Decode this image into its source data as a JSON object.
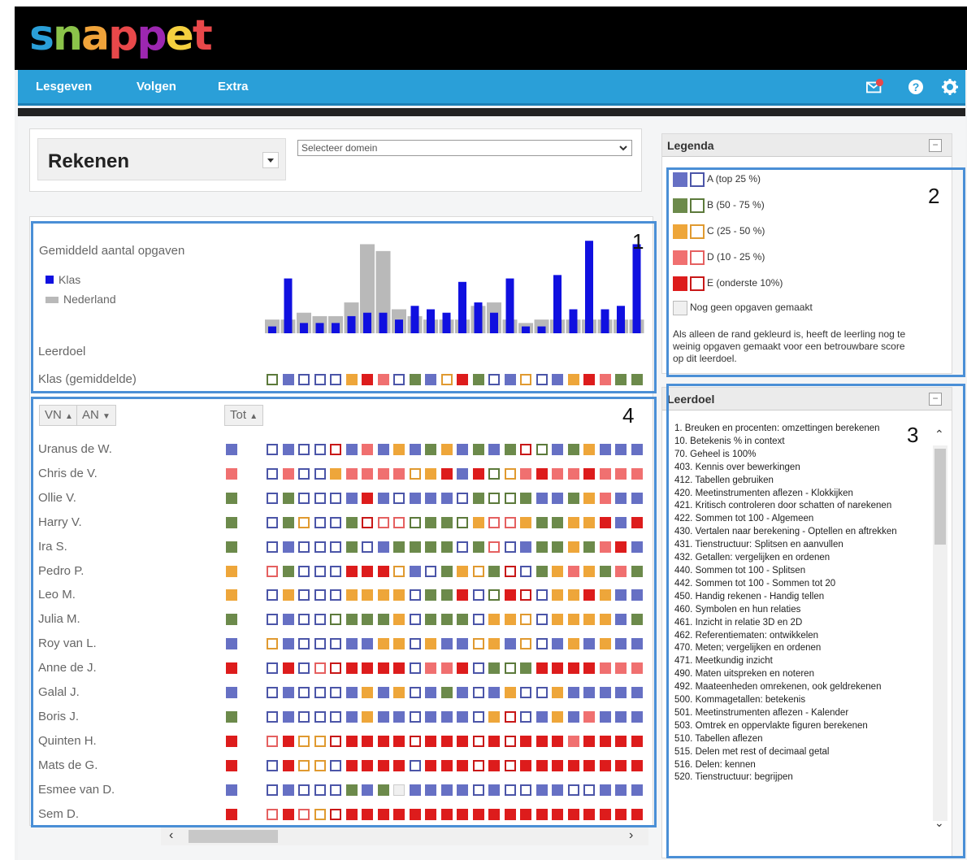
{
  "app": {
    "logo": "snappet",
    "logo_colors": [
      "#2a9fd8",
      "#8bc34a",
      "#f0a33a",
      "#e8484a",
      "#9c27b0",
      "#f4d03f",
      "#e8484a"
    ]
  },
  "nav": {
    "items": [
      "Lesgeven",
      "Volgen",
      "Extra"
    ],
    "icons": [
      "mail-icon",
      "help-icon",
      "gear-icon"
    ]
  },
  "filters": {
    "subject": "Rekenen",
    "domain_placeholder": "Selecteer domein"
  },
  "colors": {
    "A": "#6670c4",
    "B": "#6c8a4b",
    "C": "#eea63a",
    "D": "#f07070",
    "E": "#dd1c1c",
    "none": "#ffffff",
    "border_A": "#4b55a8",
    "border_B": "#5c7a3b",
    "border_C": "#e09a30",
    "border_D": "#e56060",
    "border_E": "#c81818",
    "class_bar": "#1010e0",
    "nl_bar": "#b9b9b9",
    "highlight": "#4a8fd6"
  },
  "chart": {
    "title": "Gemiddeld aantal opgaven",
    "legend": [
      "Klas",
      "Nederland"
    ],
    "row_leerdoel": "Leerdoel",
    "row_klas": "Klas (gemiddelde)",
    "callout": "1"
  },
  "chart_data": {
    "type": "bar",
    "title": "Gemiddeld aantal opgaven",
    "series": [
      {
        "name": "Klas",
        "values": [
          2,
          16,
          3,
          3,
          3,
          5,
          6,
          6,
          4,
          8,
          7,
          6,
          15,
          9,
          6,
          16,
          2,
          2,
          17,
          7,
          27,
          7,
          8,
          26
        ]
      },
      {
        "name": "Nederland",
        "values": [
          4,
          4,
          6,
          5,
          5,
          9,
          26,
          24,
          7,
          5,
          4,
          4,
          4,
          8,
          9,
          4,
          3,
          4,
          4,
          4,
          4,
          4,
          4,
          4
        ]
      }
    ]
  },
  "klas_avg": [
    "oB",
    "A",
    "oA",
    "oA",
    "oA",
    "C",
    "E",
    "D",
    "oA",
    "B",
    "A",
    "oC",
    "E",
    "B",
    "oA",
    "A",
    "oC",
    "oA",
    "A",
    "C",
    "E",
    "D",
    "B",
    "B"
  ],
  "legend_panel": {
    "title": "Legenda",
    "callout": "2",
    "rows": [
      {
        "key": "A",
        "label": "A (top 25 %)"
      },
      {
        "key": "B",
        "label": "B (50 - 75 %)"
      },
      {
        "key": "C",
        "label": "C (25 - 50 %)"
      },
      {
        "key": "D",
        "label": "D (10 - 25 %)"
      },
      {
        "key": "E",
        "label": "E (onderste 10%)"
      }
    ],
    "none_label": "Nog geen opgaven gemaakt",
    "note": "Als alleen de rand gekleurd is, heeft de leerling nog te weinig opgaven gemaakt voor een betrouwbare score op dit leerdoel."
  },
  "goal_panel": {
    "title": "Leerdoel",
    "callout": "3",
    "items": [
      "1. Breuken en procenten: omzettingen berekenen",
      "10. Betekenis % in context",
      "70. Geheel is 100%",
      "403. Kennis over bewerkingen",
      "412. Tabellen gebruiken",
      "420. Meetinstrumenten aflezen - Klokkijken",
      "421. Kritisch controleren door schatten of narekenen",
      "422. Sommen tot 100 - Algemeen",
      "430. Vertalen naar berekening - Optellen en aftrekken",
      "431. Tienstructuur: Splitsen en aanvullen",
      "432. Getallen: vergelijken en ordenen",
      "440. Sommen tot 100 - Splitsen",
      "442. Sommen tot 100 - Sommen tot 20",
      "450. Handig rekenen - Handig tellen",
      "460. Symbolen en hun relaties",
      "461. Inzicht in relatie 3D en 2D",
      "462. Referentiematen: ontwikkelen",
      "470. Meten; vergelijken en ordenen",
      "471. Meetkundig inzicht",
      "490. Maten uitspreken en noteren",
      "492. Maateenheden omrekenen, ook geldrekenen",
      "500. Kommagetallen: betekenis",
      "501. Meetinstrumenten aflezen - Kalender",
      "503. Omtrek en oppervlakte figuren berekenen",
      "510. Tabellen aflezen",
      "515. Delen met rest of decimaal getal",
      "516. Delen: kennen",
      "520. Tienstructuur: begrijpen"
    ]
  },
  "students_panel": {
    "callout": "4",
    "sort_vn": "VN",
    "sort_an": "AN",
    "sort_tot": "Tot",
    "students": [
      {
        "name": "Uranus de W.",
        "tot": "A",
        "cells": [
          "oA",
          "A",
          "oA",
          "oA",
          "oE",
          "A",
          "D",
          "A",
          "C",
          "A",
          "B",
          "C",
          "A",
          "B",
          "A",
          "B",
          "oE",
          "oB",
          "A",
          "B",
          "C",
          "A",
          "A",
          "A"
        ]
      },
      {
        "name": "Chris de V.",
        "tot": "D",
        "cells": [
          "oA",
          "D",
          "oA",
          "oA",
          "C",
          "D",
          "D",
          "D",
          "D",
          "oC",
          "C",
          "E",
          "A",
          "E",
          "oB",
          "oC",
          "D",
          "E",
          "D",
          "D",
          "E",
          "D",
          "D",
          "D"
        ]
      },
      {
        "name": "Ollie V.",
        "tot": "B",
        "cells": [
          "oA",
          "B",
          "oA",
          "oA",
          "oA",
          "A",
          "E",
          "A",
          "oA",
          "A",
          "A",
          "A",
          "oA",
          "B",
          "oB",
          "oB",
          "B",
          "A",
          "A",
          "B",
          "C",
          "D",
          "A",
          "A"
        ]
      },
      {
        "name": "Harry V.",
        "tot": "B",
        "cells": [
          "oA",
          "B",
          "oC",
          "oA",
          "oA",
          "B",
          "oE",
          "oD",
          "oD",
          "oB",
          "B",
          "B",
          "oB",
          "C",
          "oD",
          "oD",
          "C",
          "B",
          "B",
          "C",
          "C",
          "E",
          "A",
          "E"
        ]
      },
      {
        "name": "Ira S.",
        "tot": "B",
        "cells": [
          "oA",
          "A",
          "oA",
          "oA",
          "oA",
          "B",
          "oA",
          "A",
          "B",
          "B",
          "B",
          "B",
          "oA",
          "B",
          "oD",
          "oA",
          "A",
          "B",
          "B",
          "C",
          "B",
          "D",
          "E",
          "A"
        ]
      },
      {
        "name": "Pedro P.",
        "tot": "C",
        "cells": [
          "oD",
          "B",
          "oA",
          "oA",
          "oA",
          "E",
          "E",
          "E",
          "oC",
          "A",
          "oA",
          "B",
          "C",
          "oC",
          "B",
          "oE",
          "oA",
          "B",
          "C",
          "D",
          "C",
          "B",
          "D",
          "B"
        ]
      },
      {
        "name": "Leo M.",
        "tot": "C",
        "cells": [
          "oA",
          "C",
          "oA",
          "oA",
          "oA",
          "C",
          "C",
          "C",
          "C",
          "oA",
          "B",
          "B",
          "E",
          "oA",
          "oB",
          "E",
          "oE",
          "oA",
          "C",
          "C",
          "E",
          "C",
          "A",
          "A"
        ]
      },
      {
        "name": "Julia M.",
        "tot": "B",
        "cells": [
          "oA",
          "A",
          "oA",
          "oA",
          "oB",
          "B",
          "B",
          "B",
          "C",
          "oA",
          "B",
          "B",
          "B",
          "oA",
          "C",
          "C",
          "oC",
          "oA",
          "C",
          "C",
          "C",
          "C",
          "A",
          "B"
        ]
      },
      {
        "name": "Roy van L.",
        "tot": "A",
        "cells": [
          "oC",
          "A",
          "oA",
          "oA",
          "oA",
          "A",
          "A",
          "C",
          "C",
          "oA",
          "C",
          "A",
          "A",
          "oC",
          "C",
          "A",
          "oC",
          "oA",
          "A",
          "C",
          "A",
          "C",
          "A",
          "A"
        ]
      },
      {
        "name": "Anne de J.",
        "tot": "E",
        "cells": [
          "oA",
          "E",
          "oA",
          "oD",
          "oE",
          "E",
          "E",
          "E",
          "E",
          "oA",
          "D",
          "D",
          "E",
          "oA",
          "B",
          "oB",
          "B",
          "E",
          "E",
          "E",
          "E",
          "D",
          "D",
          "D"
        ]
      },
      {
        "name": "Galal J.",
        "tot": "A",
        "cells": [
          "oA",
          "A",
          "oA",
          "oA",
          "oA",
          "A",
          "C",
          "A",
          "C",
          "oA",
          "A",
          "B",
          "A",
          "oA",
          "A",
          "C",
          "oA",
          "oA",
          "C",
          "A",
          "A",
          "A",
          "A",
          "A"
        ]
      },
      {
        "name": "Boris J.",
        "tot": "B",
        "cells": [
          "oA",
          "A",
          "oA",
          "oA",
          "oA",
          "A",
          "C",
          "A",
          "A",
          "oA",
          "A",
          "A",
          "A",
          "oA",
          "C",
          "oE",
          "oA",
          "A",
          "C",
          "A",
          "D",
          "A",
          "A",
          "A"
        ]
      },
      {
        "name": "Quinten H.",
        "tot": "E",
        "cells": [
          "oD",
          "E",
          "oC",
          "oC",
          "oE",
          "E",
          "E",
          "E",
          "E",
          "oE",
          "E",
          "E",
          "E",
          "oE",
          "E",
          "oE",
          "E",
          "E",
          "E",
          "D",
          "E",
          "E",
          "E",
          "E"
        ]
      },
      {
        "name": "Mats de G.",
        "tot": "E",
        "cells": [
          "oA",
          "E",
          "oC",
          "oC",
          "oA",
          "E",
          "E",
          "E",
          "E",
          "oA",
          "E",
          "E",
          "E",
          "oE",
          "E",
          "oE",
          "E",
          "E",
          "E",
          "E",
          "E",
          "E",
          "E",
          "E"
        ]
      },
      {
        "name": "Esmee van D.",
        "tot": "A",
        "cells": [
          "oA",
          "A",
          "oA",
          "oA",
          "oA",
          "B",
          "A",
          "B",
          "none",
          "A",
          "A",
          "A",
          "A",
          "oA",
          "A",
          "oA",
          "oA",
          "A",
          "A",
          "oA",
          "oA",
          "A",
          "A",
          "A"
        ]
      },
      {
        "name": "Sem D.",
        "tot": "E",
        "cells": [
          "oD",
          "E",
          "oD",
          "oC",
          "oE",
          "E",
          "E",
          "E",
          "E",
          "E",
          "E",
          "E",
          "E",
          "E",
          "E",
          "E",
          "E",
          "E",
          "E",
          "E",
          "E",
          "E",
          "E",
          "E"
        ]
      }
    ]
  }
}
